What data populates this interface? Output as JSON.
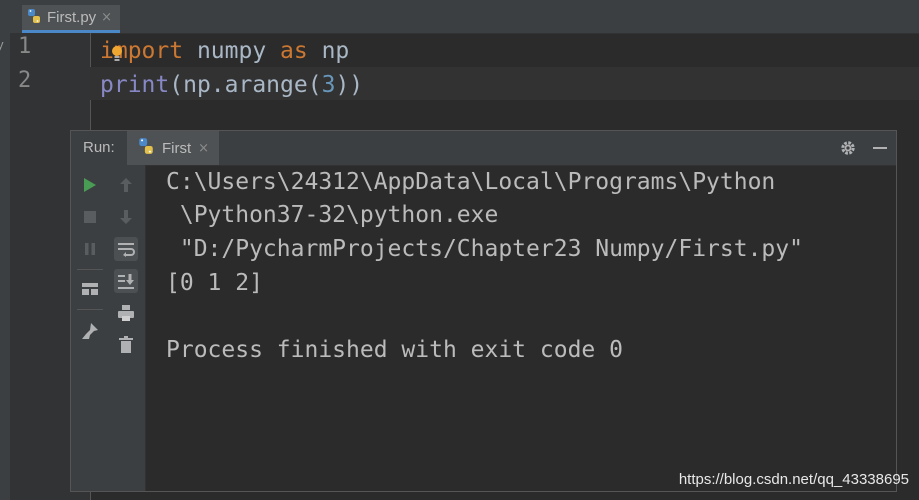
{
  "editor": {
    "tab": {
      "label": "First.py",
      "close": "×"
    },
    "left_strip_label": "y",
    "line_numbers": [
      "1",
      "2"
    ],
    "line1": {
      "kw_import": "import",
      "module": " numpy ",
      "kw_as": "as",
      "alias": " np"
    },
    "line2": {
      "builtin": "print",
      "open": "(np.arange(",
      "number": "3",
      "close": "))"
    }
  },
  "run": {
    "title": "Run:",
    "tab": {
      "label": "First",
      "close": "×"
    },
    "output": [
      "C:\\Users\\24312\\AppData\\Local\\Programs\\Python",
      " \\Python37-32\\python.exe",
      " \"D:/PycharmProjects/Chapter23 Numpy/First.py\"",
      "[0 1 2]",
      "",
      "Process finished with exit code 0"
    ]
  },
  "watermark": "https://blog.csdn.net/qq_43338695",
  "colors": {
    "keyword": "#cc7832",
    "builtin": "#8888c6",
    "number": "#6897bb",
    "text": "#a9b7c6",
    "run_green": "#499c54"
  }
}
